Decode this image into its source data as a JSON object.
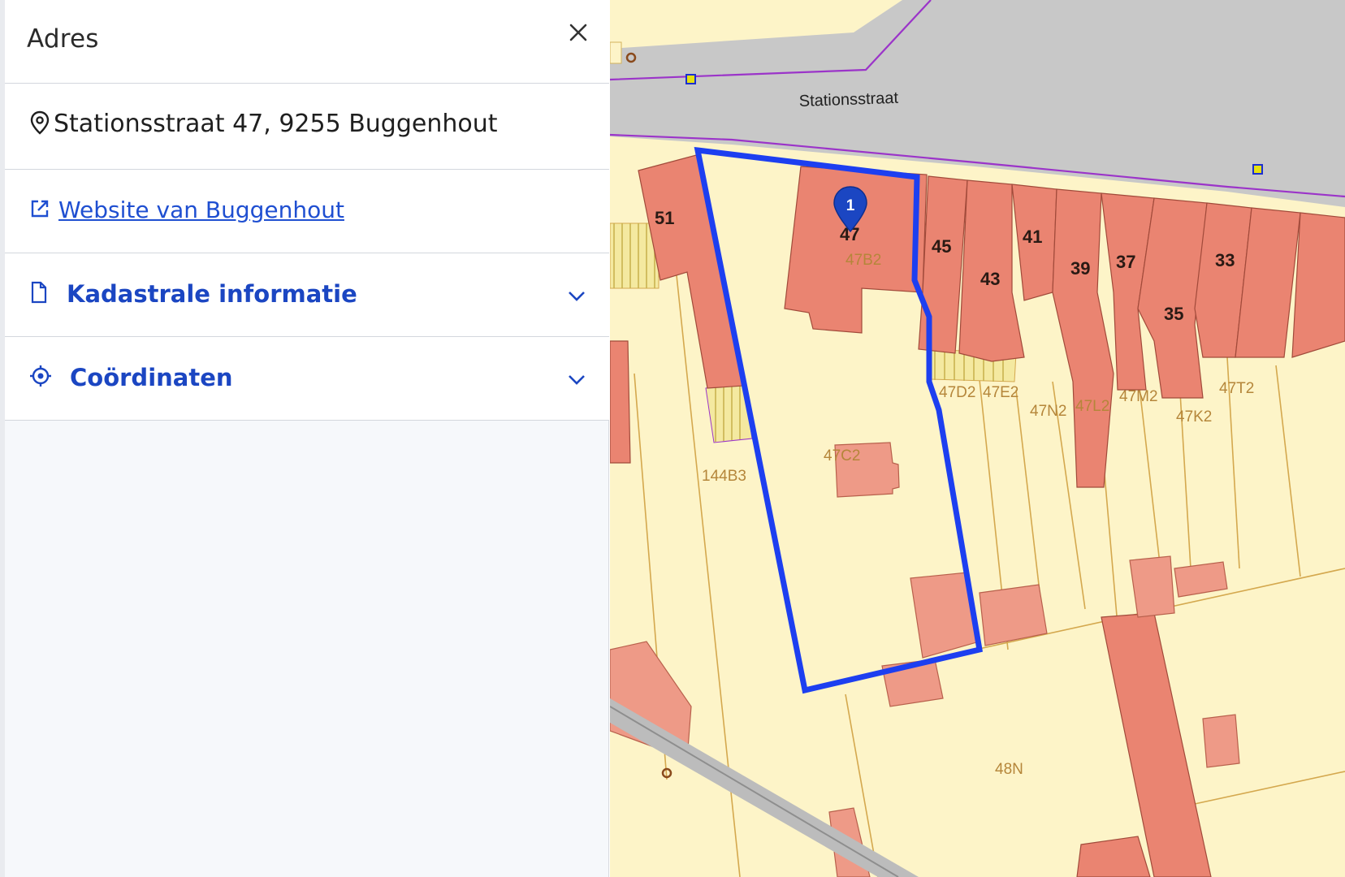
{
  "panel": {
    "title": "Adres",
    "close_icon": "close-icon",
    "address": {
      "icon": "map-pin-icon",
      "text": "Stationsstraat 47, 9255 Buggenhout"
    },
    "website": {
      "icon": "external-link-icon",
      "label": "Website van Buggenhout"
    },
    "sections": [
      {
        "icon": "document-icon",
        "label": "Kadastrale informatie",
        "expanded": false
      },
      {
        "icon": "crosshair-icon",
        "label": "Coördinaten",
        "expanded": false
      }
    ]
  },
  "map": {
    "street_name": "Stationsstraat",
    "marker_label": "1",
    "house_numbers": [
      "51",
      "47",
      "45",
      "43",
      "41",
      "39",
      "37",
      "35",
      "33"
    ],
    "parcel_labels": [
      "47B2",
      "47C2",
      "144B3",
      "47D2",
      "47E2",
      "47N2",
      "47L2",
      "47M2",
      "47K2",
      "47T2",
      "48N"
    ],
    "colors": {
      "road": "#c8c8c8",
      "parcel_fill": "#fdf4c8",
      "building": "#ea8471",
      "selection": "#1d3ff0",
      "boundary": "#9b34c9",
      "accent": "#1b46c2"
    }
  }
}
